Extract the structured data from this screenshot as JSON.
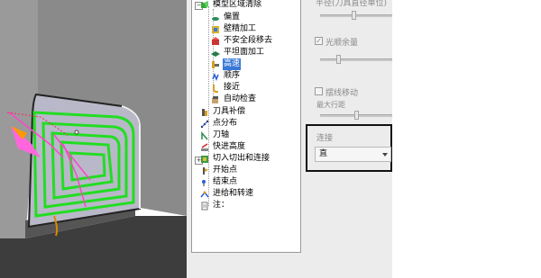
{
  "tree": {
    "items": [
      {
        "label": "模型区域清除",
        "icon": "model-region-icon",
        "level": 0,
        "expanded": true
      },
      {
        "label": "偏置",
        "icon": "offset-icon",
        "level": 1
      },
      {
        "label": "壁精加工",
        "icon": "wall-finish-icon",
        "level": 1
      },
      {
        "label": "不安全段移去",
        "icon": "unsafe-segment-icon",
        "level": 1
      },
      {
        "label": "平坦面加工",
        "icon": "flat-face-icon",
        "level": 1
      },
      {
        "label": "高速",
        "icon": "high-speed-icon",
        "level": 1,
        "selected": true
      },
      {
        "label": "顺序",
        "icon": "order-icon",
        "level": 1
      },
      {
        "label": "接近",
        "icon": "approach-icon",
        "level": 1
      },
      {
        "label": "自动检查",
        "icon": "auto-check-icon",
        "level": 1
      },
      {
        "label": "刀具补偿",
        "icon": "tool-compensation-icon",
        "level": 0
      },
      {
        "label": "点分布",
        "icon": "point-distribution-icon",
        "level": 0
      },
      {
        "label": "刀轴",
        "icon": "tool-axis-icon",
        "level": 0
      },
      {
        "label": "快进高度",
        "icon": "rapid-height-icon",
        "level": 0
      },
      {
        "label": "切入切出和连接",
        "icon": "leads-links-icon",
        "level": 0,
        "collapsed": true
      },
      {
        "label": "开始点",
        "icon": "start-point-icon",
        "level": 0
      },
      {
        "label": "结束点",
        "icon": "end-point-icon",
        "level": 0
      },
      {
        "label": "进给和转速",
        "icon": "feed-speed-icon",
        "level": 0
      },
      {
        "label": "注：",
        "icon": "note-icon",
        "level": 0
      }
    ]
  },
  "props": {
    "radius_label": "半径(刀具直径单位)",
    "smooth_allowance_label": "光顺余量",
    "smooth_allowance_checked": true,
    "trochoidal_label": "摆线移动",
    "trochoidal_checked": false,
    "max_path_label": "最大行距",
    "link_label": "连接",
    "link_value": "直"
  },
  "colors": {
    "selection": "#3a78d8",
    "toolpath": "#22dd22",
    "highlight_box": "#111111"
  }
}
